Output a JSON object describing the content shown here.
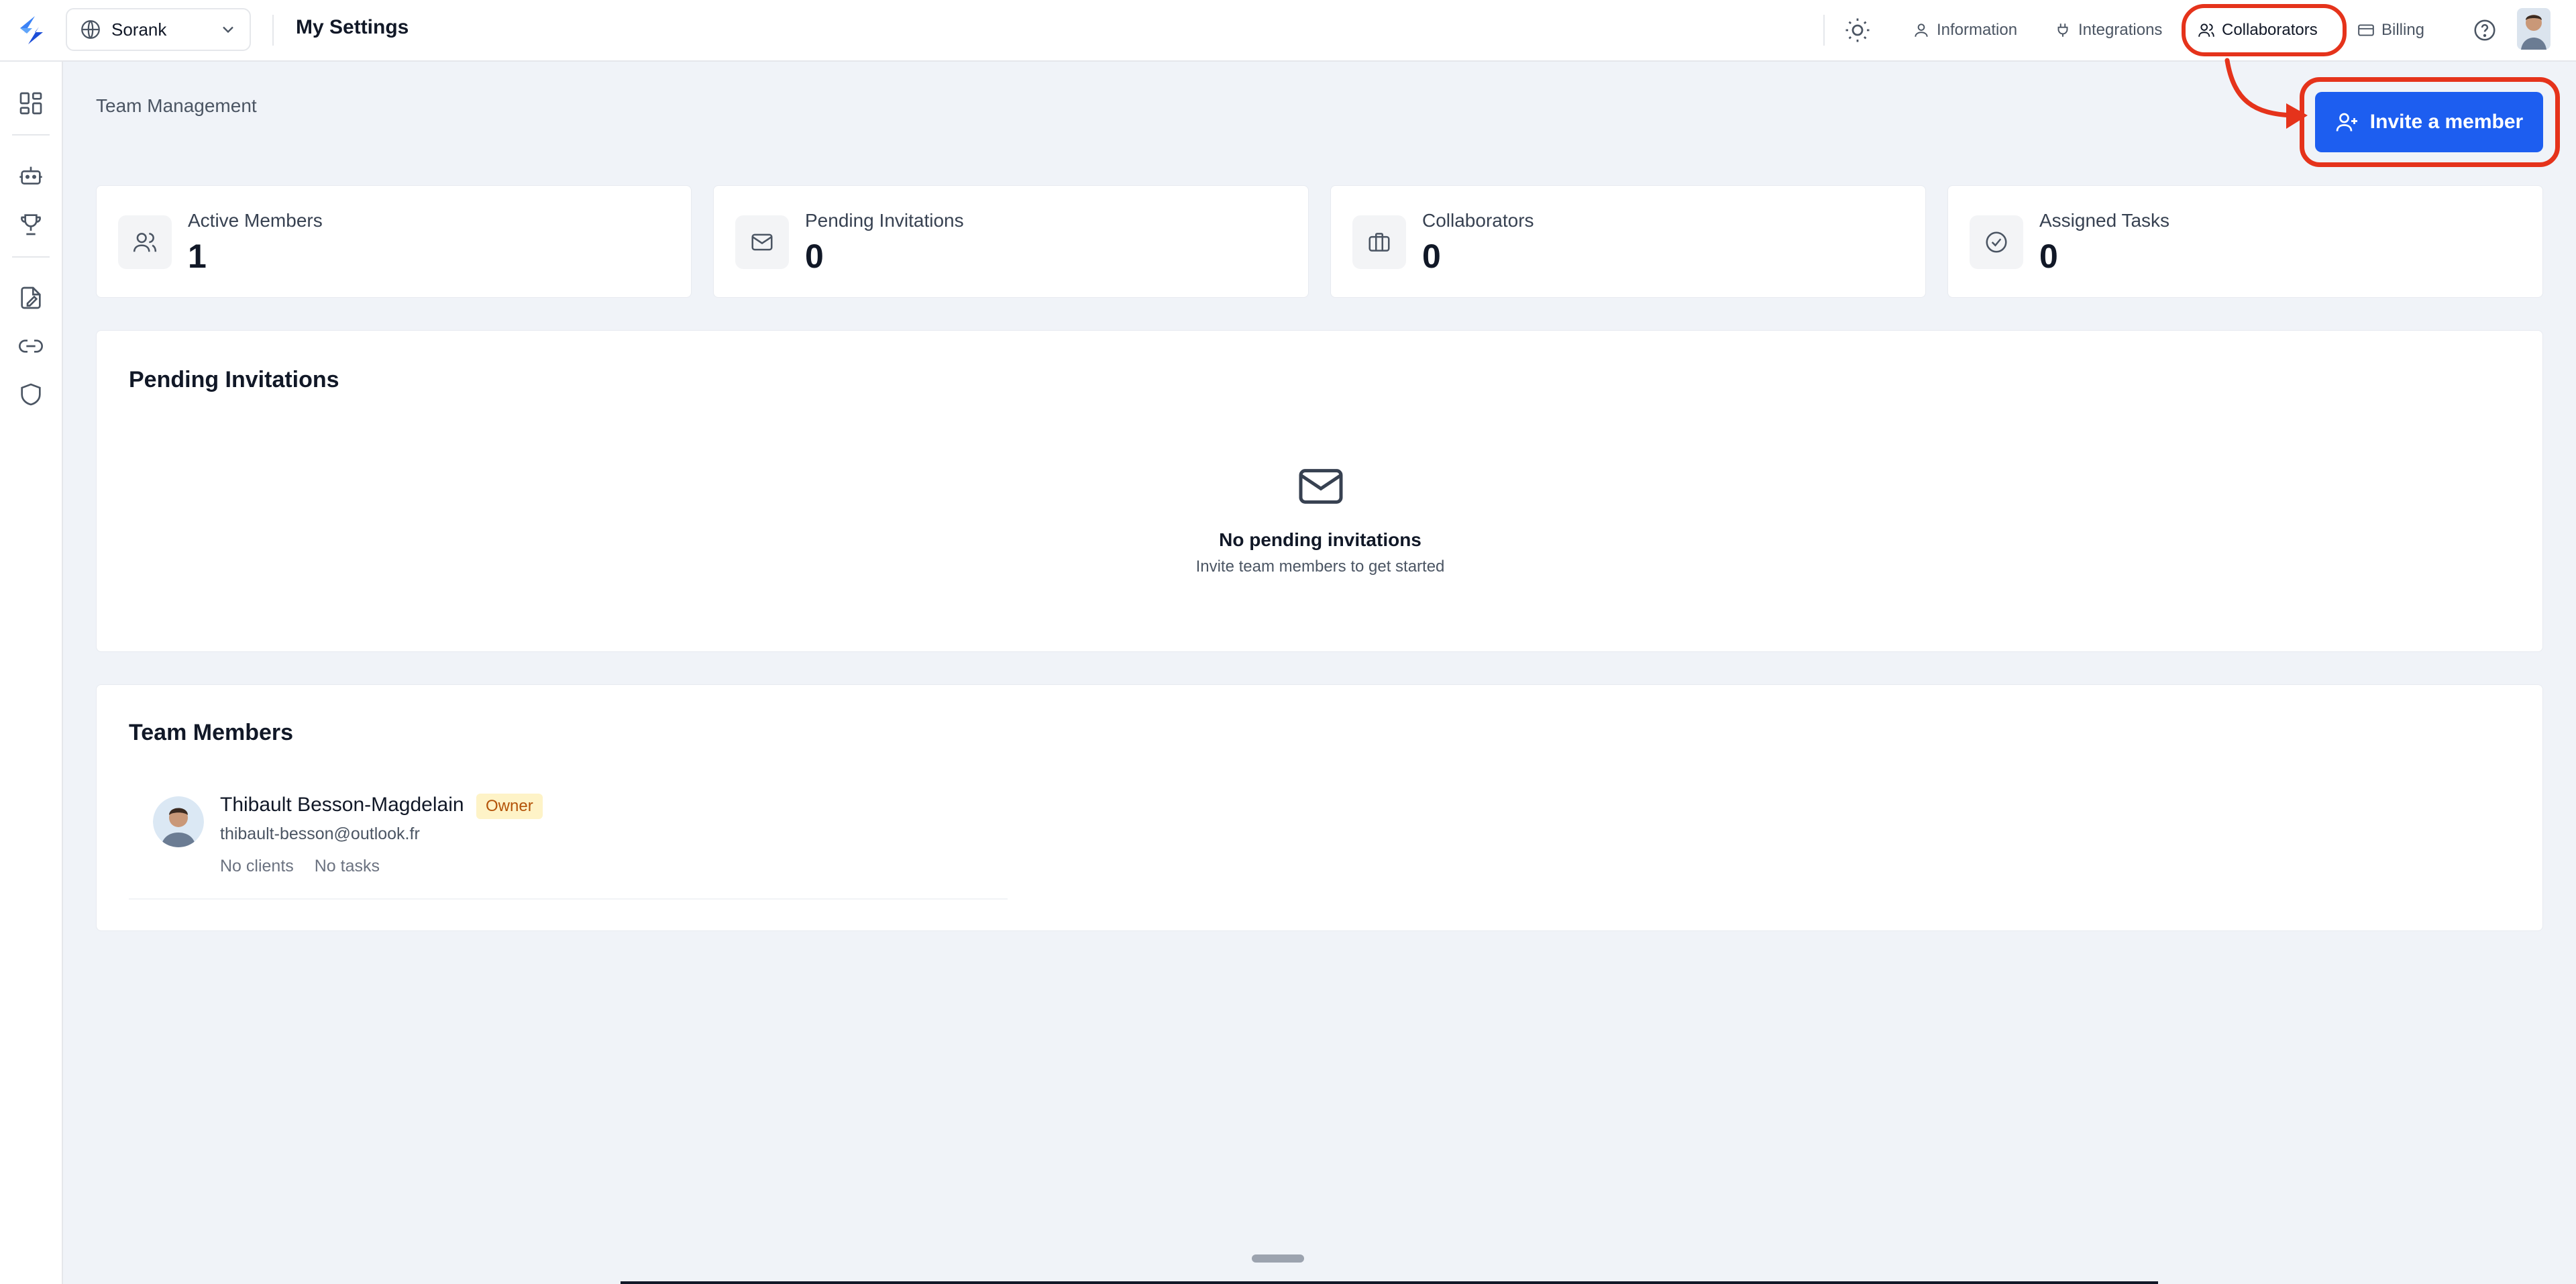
{
  "app": {
    "workspace_name": "Sorank",
    "page_title": "My Settings",
    "accent_color": "#1d5ef0",
    "annotation_color": "#e5331b"
  },
  "nav_tabs": [
    {
      "label": "Information",
      "icon": "user-icon",
      "active": false
    },
    {
      "label": "Integrations",
      "icon": "plug-icon",
      "active": false
    },
    {
      "label": "Collaborators",
      "icon": "users-icon",
      "active": true
    },
    {
      "label": "Billing",
      "icon": "credit-card-icon",
      "active": false
    }
  ],
  "sidebar": {
    "items": [
      {
        "icon": "dashboard-icon"
      },
      {
        "icon": "robot-icon"
      },
      {
        "icon": "trophy-icon"
      },
      {
        "icon": "document-edit-icon"
      },
      {
        "icon": "link-icon"
      },
      {
        "icon": "shield-icon"
      }
    ]
  },
  "main": {
    "section_heading": "Team Management",
    "invite_button_label": "Invite a member",
    "stats": [
      {
        "label": "Active Members",
        "value": "1",
        "icon": "users-icon"
      },
      {
        "label": "Pending Invitations",
        "value": "0",
        "icon": "mail-icon"
      },
      {
        "label": "Collaborators",
        "value": "0",
        "icon": "briefcase-icon"
      },
      {
        "label": "Assigned Tasks",
        "value": "0",
        "icon": "check-circle-icon"
      }
    ],
    "pending": {
      "title": "Pending Invitations",
      "empty_title": "No pending invitations",
      "empty_subtitle": "Invite team members to get started"
    },
    "team": {
      "title": "Team Members",
      "members": [
        {
          "name": "Thibault Besson-Magdelain",
          "role": "Owner",
          "email": "thibault-besson@outlook.fr",
          "clients": "No clients",
          "tasks": "No tasks"
        }
      ]
    }
  }
}
